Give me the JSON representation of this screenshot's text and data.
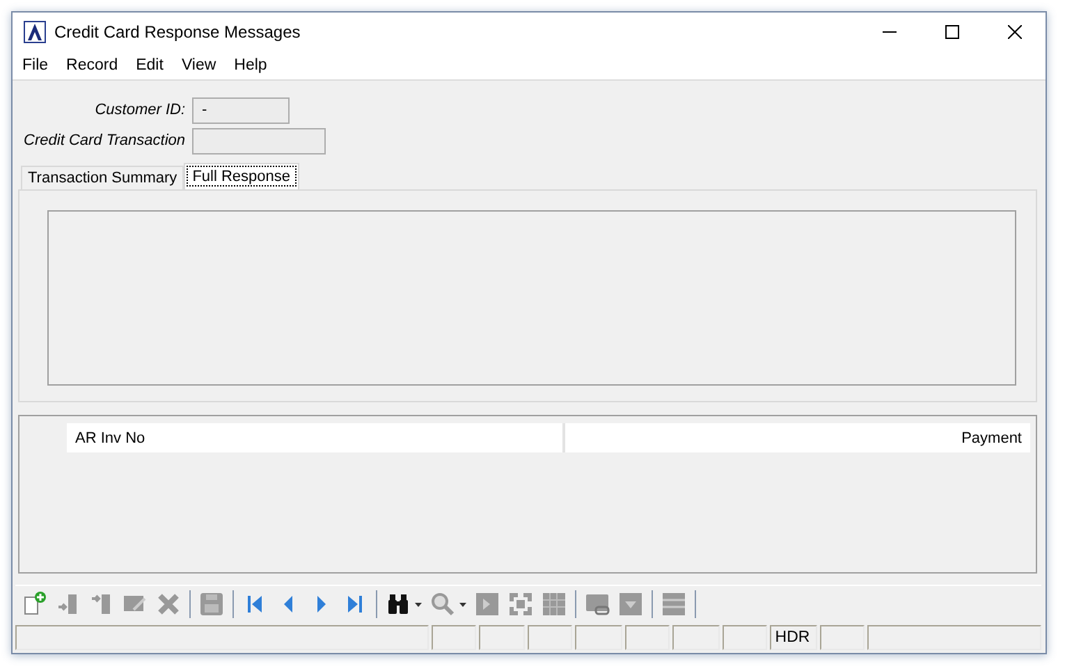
{
  "window": {
    "title": "Credit Card Response Messages"
  },
  "menu": [
    "File",
    "Record",
    "Edit",
    "View",
    "Help"
  ],
  "fields": [
    {
      "label": "Customer ID:",
      "value": "-"
    },
    {
      "label": "Credit Card Transaction"
    }
  ],
  "tabs": [
    {
      "label": "Transaction Summary",
      "selected": false
    },
    {
      "label": "Full Response",
      "selected": true
    }
  ],
  "grid": {
    "columns": [
      "AR Inv No",
      "Payment"
    ]
  },
  "toolbar": [
    {
      "kind": "new",
      "disabled": false
    },
    {
      "kind": "insert",
      "disabled": true
    },
    {
      "kind": "insert-above",
      "disabled": true
    },
    {
      "kind": "edit",
      "disabled": true
    },
    {
      "kind": "delete",
      "disabled": true
    },
    {
      "kind": "separator"
    },
    {
      "kind": "save",
      "disabled": true
    },
    {
      "kind": "separator"
    },
    {
      "kind": "first",
      "disabled": false
    },
    {
      "kind": "prev",
      "disabled": false
    },
    {
      "kind": "next",
      "disabled": false
    },
    {
      "kind": "last",
      "disabled": false
    },
    {
      "kind": "separator"
    },
    {
      "kind": "find",
      "disabled": false
    },
    {
      "kind": "dropdown",
      "disabled": false
    },
    {
      "kind": "zoom",
      "disabled": true
    },
    {
      "kind": "dropdown",
      "disabled": false
    },
    {
      "kind": "export",
      "disabled": true
    },
    {
      "kind": "expand",
      "disabled": true
    },
    {
      "kind": "grid",
      "disabled": true
    },
    {
      "kind": "separator"
    },
    {
      "kind": "link",
      "disabled": true
    },
    {
      "kind": "filter",
      "disabled": true
    },
    {
      "kind": "separator"
    },
    {
      "kind": "list",
      "disabled": true
    },
    {
      "kind": "separator"
    }
  ],
  "status_bar": {
    "mode": "HDR"
  }
}
